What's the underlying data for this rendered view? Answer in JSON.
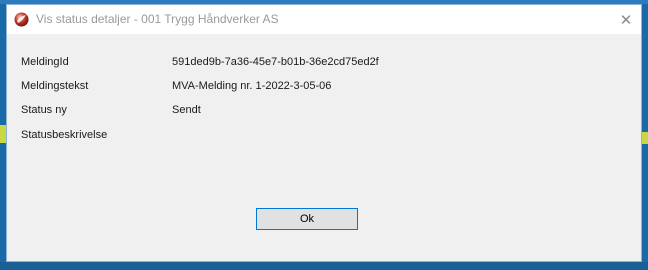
{
  "window": {
    "title": "Vis status detaljer - 001 Trygg Håndverker AS",
    "app_icon": "app-logo-icon",
    "close_glyph": "✕"
  },
  "fields": [
    {
      "label": "MeldingId",
      "value": "591ded9b-7a36-45e7-b01b-36e2cd75ed2f"
    },
    {
      "label": "Meldingstekst",
      "value": "MVA-Melding nr. 1-2022-3-05-06"
    },
    {
      "label": "Status ny",
      "value": "Sendt"
    },
    {
      "label": "Statusbeskrivelse",
      "value": ""
    }
  ],
  "buttons": {
    "ok_label": "Ok"
  },
  "colors": {
    "desktop": "#1a6fb0",
    "dialog_bg": "#f0f0f0",
    "focus_border": "#0078d7",
    "accent_strip": "#c9d842"
  }
}
